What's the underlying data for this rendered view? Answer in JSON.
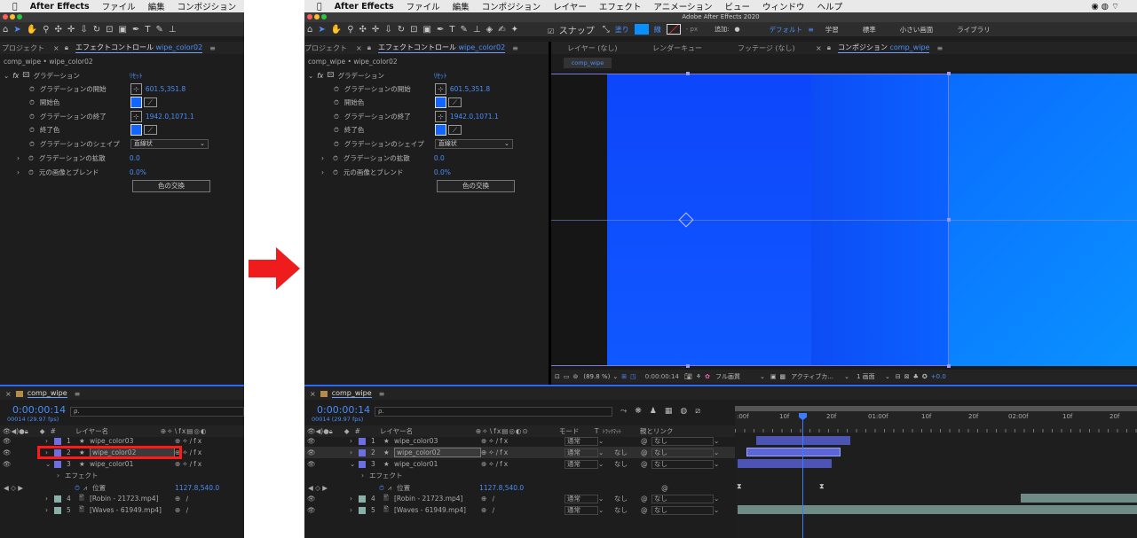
{
  "menu": {
    "app": "After Effects",
    "items_left": [
      "ファイル",
      "編集",
      "コンポジション",
      "レイ"
    ],
    "items_right": [
      "ファイル",
      "編集",
      "コンポジション",
      "レイヤー",
      "エフェクト",
      "アニメーション",
      "ビュー",
      "ウィンドウ",
      "ヘルプ"
    ]
  },
  "window_title": "Adobe After Effects 2020",
  "toolbar": {
    "snap": "スナップ",
    "fill": "塗り",
    "stroke": "線",
    "px": "- px",
    "add": "追加:",
    "workspaces": [
      "デフォルト",
      "学習",
      "標準",
      "小さい画面",
      "ライブラリ"
    ]
  },
  "effect_panel": {
    "tab_project": "プロジェクト",
    "tab_effect": "エフェクトコントロール",
    "tab_effect_layer": "wipe_color02",
    "breadcrumb": "comp_wipe • wipe_color02",
    "effect_name": "グラデーション",
    "reset": "ﾘｾｯﾄ",
    "props": {
      "start_label": "グラデーションの開始",
      "start_value": "601.5,351.8",
      "start_color_label": "開始色",
      "end_label": "グラデーションの終了",
      "end_value": "1942.0,1071.1",
      "end_color_label": "終了色",
      "shape_label": "グラデーションのシェイプ",
      "shape_value": "直線状",
      "scatter_label": "グラデーションの拡散",
      "scatter_value": "0.0",
      "blend_label": "元の画像とブレンド",
      "blend_value": "0.0%",
      "swap_button": "色の交換"
    },
    "start_color": "#1060ff",
    "end_color": "#0a78ff"
  },
  "viewer": {
    "tabs": [
      "レイヤー (なし)",
      "レンダーキュー",
      "フッテージ (なし)",
      "コンポジション"
    ],
    "comp_tab_name": "comp_wipe",
    "comp_chip": "comp_wipe",
    "zoom": "(89.8 %)",
    "time": "0:00:00:14",
    "quality": "フル画質",
    "camera": "アクティブカ...",
    "views": "1 画面",
    "exposure": "+0.0"
  },
  "timeline": {
    "comp": "comp_wipe",
    "timecode": "0:00:00:14",
    "fps": "00014 (29.97 fps)",
    "search_placeholder": "ρ.",
    "col_layer": "レイヤー名",
    "col_num": "#",
    "col_mode": "モード",
    "col_t": "T",
    "col_trkmat": "ﾄﾗｯｸﾏｯﾄ",
    "col_parent": "親とリンク",
    "effect_label": "エフェクト",
    "position_label": "位置",
    "position_value": "1127.8,540.0",
    "ruler": [
      ":00f",
      "10f",
      "20f",
      "01:00f",
      "10f",
      "20f",
      "02:00f",
      "10f",
      "20f"
    ],
    "layers": [
      {
        "num": "1",
        "name": "wipe_color03",
        "mode": "通常",
        "trk": "",
        "parent": "なし",
        "color": "#6b6fe0"
      },
      {
        "num": "2",
        "name": "wipe_color02",
        "mode": "通常",
        "trk": "なし",
        "parent": "なし",
        "color": "#6b6fe0"
      },
      {
        "num": "3",
        "name": "wipe_color01",
        "mode": "通常",
        "trk": "なし",
        "parent": "なし",
        "color": "#6b6fe0"
      },
      {
        "num": "4",
        "name": "[Robin - 21723.mp4]",
        "mode": "通常",
        "trk": "なし",
        "parent": "なし",
        "color": "#8ab1a9"
      },
      {
        "num": "5",
        "name": "[Waves - 61949.mp4]",
        "mode": "通常",
        "trk": "なし",
        "parent": "なし",
        "color": "#8ab1a9"
      }
    ]
  }
}
